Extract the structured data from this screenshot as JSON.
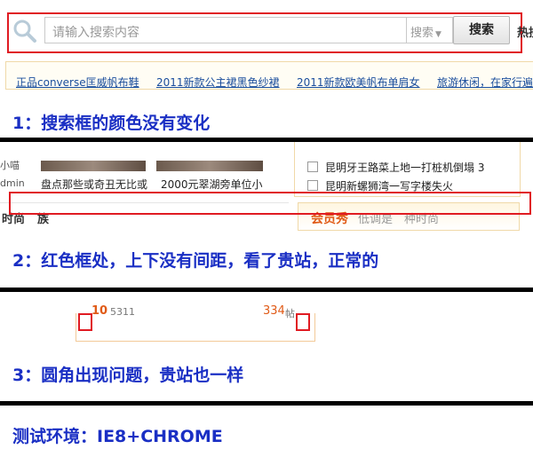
{
  "search": {
    "placeholder": "请输入搜索内容",
    "scope": "搜索",
    "button": "搜索",
    "hot_label_trunc": "热搜"
  },
  "hotwords": [
    "正品converse匡威帆布鞋",
    "2011新款公主裙黑色纱裙",
    "2011新款欧美帆布单肩女",
    "旅游休闲，在家行遍"
  ],
  "captions": {
    "c1": "1：搜索框的颜色没有变化",
    "c2": "2：红色框处，上下没有间距，看了贵站，正常的",
    "c3": "3：圆角出现问题，贵站也一样",
    "c4": "测试环境：IE8+CHROME"
  },
  "section2": {
    "left_edge_top": "小喵",
    "left_edge_bottom": "dmin",
    "thumb_captions": [
      "盘点那些或奇丑无比或",
      "2000元翠湖旁单位小"
    ],
    "news": [
      "昆明牙王路菜上地一打桩机倒塌 3",
      "昆明新螺狮湾一写字楼失火"
    ],
    "tabs_left": [
      "时尚",
      "族"
    ],
    "member_title": "会员秀",
    "member_slogan": "低调是　种时尚"
  },
  "section3": {
    "left_num": "10",
    "left_small": "5311",
    "right_num": "334",
    "right_small": "帖"
  },
  "colors": {
    "accent_red": "#e01b22",
    "caption_blue": "#1a2fc4",
    "link_blue": "#1a4d9c",
    "orange": "#e05a16"
  }
}
